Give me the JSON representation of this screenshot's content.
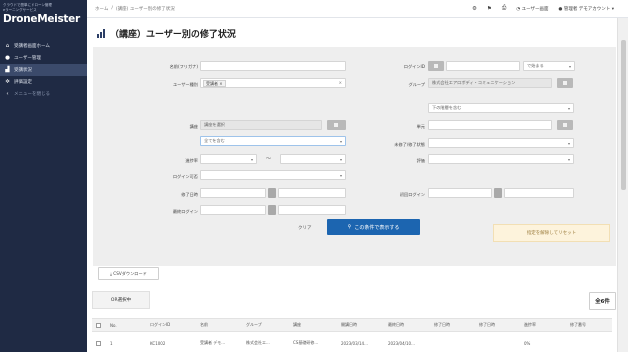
{
  "sidebar": {
    "tagline_1": "クラウドで簡単にドローン管理",
    "tagline_2": "eラーニングサービス",
    "logo": "DroneMeister",
    "items": [
      {
        "icon": "home-icon",
        "label": "受講者画面ホーム"
      },
      {
        "icon": "user-icon",
        "label": "ユーザー管理"
      },
      {
        "icon": "chart-icon",
        "label": "受講状況"
      },
      {
        "icon": "gear-icon",
        "label": "評価設定"
      },
      {
        "icon": "back-icon",
        "label": "メニューを閉じる"
      }
    ]
  },
  "header": {
    "breadcrumb": [
      "ホーム",
      "/",
      "(講座) ユーザー別の修了状況"
    ],
    "user_screen": "ユーザー画面",
    "account": "管理者 デモアカウント"
  },
  "page": {
    "title": "（講座）ユーザー別の修了状況"
  },
  "form": {
    "name_kana_label": "名前(フリガナ)",
    "login_id_label": "ログインID",
    "login_id_select": "で始まる",
    "user_type_label": "ユーザー種別",
    "user_type_tag": "受講者",
    "group_label": "グループ",
    "group_value": "株式会社エアロボディ・コミュニケーション",
    "group_subselect": "下の階層を含む",
    "course_label": "講座",
    "course_value": "講座を選択",
    "course_sub": "全てを含む",
    "unit_label": "単元",
    "progress_label": "進捗率",
    "evaluation_label": "評価",
    "completion_label": "未修了/修了状態",
    "login_status_label": "ログイン可否",
    "finish_label": "修了日時",
    "first_login_label": "初回ログイン",
    "last_login_label": "最終ログイン",
    "clear_label": "クリア",
    "search_label": "この条件で表示する",
    "reset_label": "指定を解除してリセット"
  },
  "actions": {
    "csv_download": "CSVダウンロード"
  },
  "list": {
    "status_tab": "OR選択中",
    "count": "全6件",
    "columns": [
      "No.",
      "ログインID",
      "名前",
      "グループ",
      "講座",
      "開講日時",
      "最終日時",
      "修了日時",
      "修了日時",
      "進捗率",
      "修了番号"
    ],
    "rows": [
      [
        "1",
        "KC1002",
        "受講者 デモ...",
        "株式会社エ...",
        "CS基礎研修...",
        "2023/03/14...",
        "2023/04/10...",
        "",
        "",
        "0%",
        ""
      ]
    ]
  }
}
